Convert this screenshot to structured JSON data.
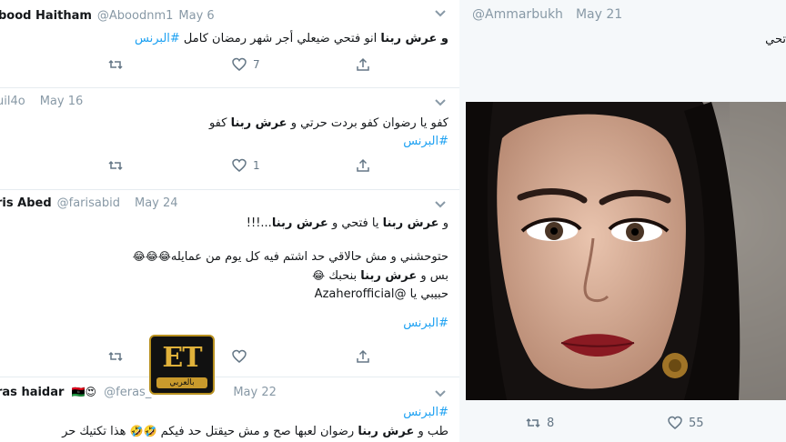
{
  "tweets": [
    {
      "name": "bood Haitham",
      "handle": "@Aboodnm1",
      "date": "May 6",
      "line1_bold": "و عرش ربنا",
      "line1_text": " انو فتحي ضيعلي أجر شهر رمضان كامل ",
      "hashtag": "#البرنس",
      "likes": "7"
    },
    {
      "name": "",
      "handle": "uil4o",
      "date": "May 16",
      "line1_text": "كفو يا رضوان كفو بردت حرتي و ",
      "line1_bold": "عرش ربنا",
      "line1_tail": " كفو",
      "hashtag": "#البرنس",
      "likes": "1"
    },
    {
      "name": "ris Abed",
      "handle": "@farisabid",
      "date": "May 24",
      "line1_a": "و ",
      "line1_bold_a": "عرش ربنا",
      "line1_b": " يا فتحي و ",
      "line1_bold_b": "عرش ربنا",
      "line1_tail": "...!!!",
      "line2": "حتوحشني و مش حالاقي حد اشتم فيه كل يوم من عمايله",
      "line2_emoji": "😂😂😂",
      "line3_a": "بس و ",
      "line3_bold": "عرش ربنا",
      "line3_b": " بنحبك ",
      "line3_emoji": "😂",
      "line4": "حبيبي يا @Azaherofficial",
      "hashtag": "#البرنس"
    },
    {
      "name": "ras haidar",
      "flags": "🇱🇾😍",
      "handle": "@feras_",
      "date": "May 22",
      "hashtag": "#البرنس",
      "line1_a": "طب و ",
      "line1_bold": "عرش ربنا",
      "line1_b": " رضوان لعبها صح و مش حيقتل حد فيكم ",
      "line1_emoji": "🤣🤣",
      "line1_c": " هذا تكتيك حر"
    }
  ],
  "right_tweet": {
    "handle": "@Ammarbukh",
    "date": "May 21",
    "text_fragment": "تحي",
    "retweets": "8",
    "likes": "55"
  },
  "logo": {
    "main": "ET",
    "sub": "بالعربي"
  },
  "colors": {
    "hashtag": "#1da1f2",
    "secondary_text": "#8899a6",
    "logo_gold": "#e0b13a"
  }
}
